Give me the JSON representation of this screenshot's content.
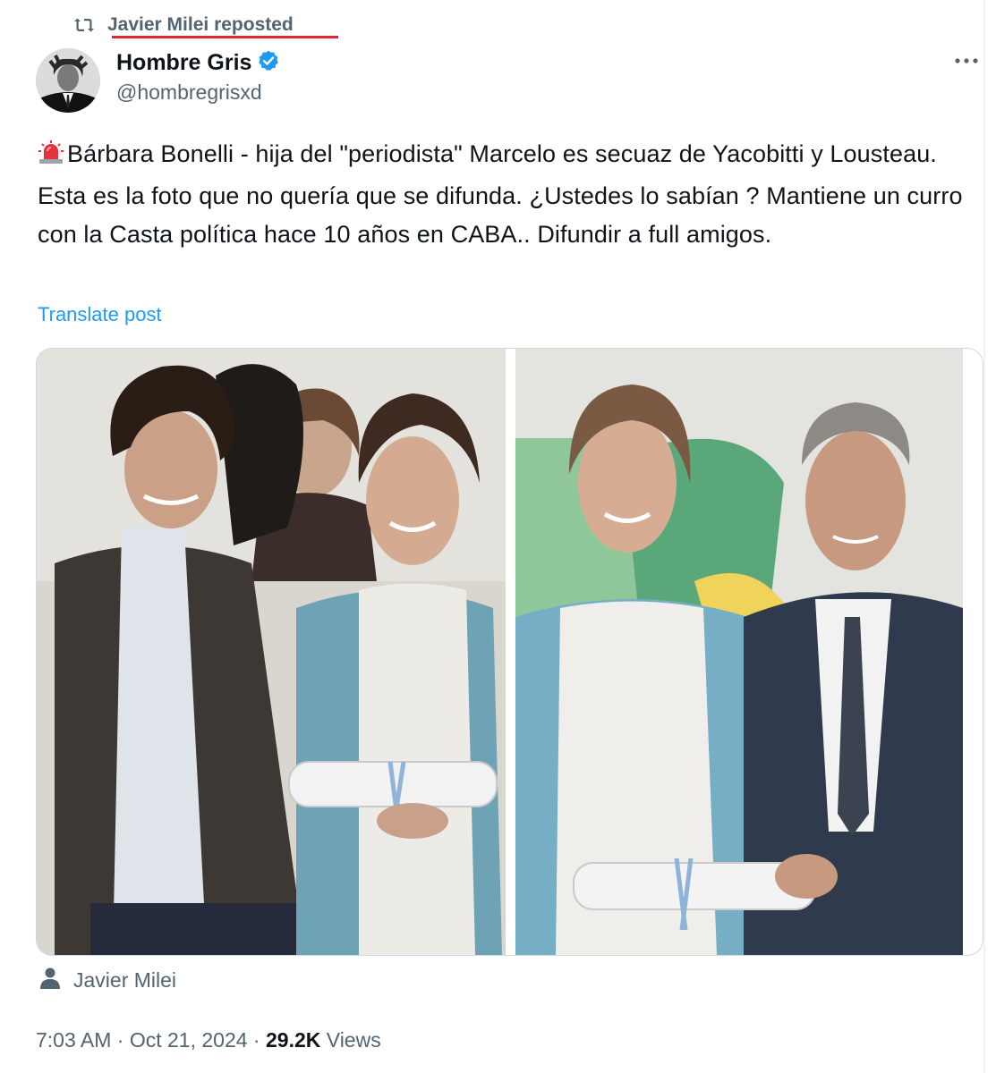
{
  "repost": {
    "icon": "repost-icon",
    "text": "Javier Milei reposted"
  },
  "author": {
    "display_name": "Hombre Gris",
    "verified": true,
    "verified_icon": "verified-badge-icon",
    "handle": "@hombregrisxd"
  },
  "more_icon": "more-options-icon",
  "post": {
    "emoji": "police-siren-icon",
    "text": "Bárbara Bonelli - hija del \"periodista\" Marcelo es secuaz de Yacobitti y Lousteau.  Esta es la foto que no quería que se difunda. ¿Ustedes lo sabían ? Mantiene un curro con la Casta política hace 10 años en CABA.. Difundir a full amigos.",
    "translate_label": "Translate post"
  },
  "media": {
    "photos": [
      {
        "name": "photo-left"
      },
      {
        "name": "photo-right"
      }
    ]
  },
  "tagged": {
    "icon": "person-icon",
    "name": "Javier Milei"
  },
  "meta": {
    "time": "7:03 AM",
    "separator": " · ",
    "date": "Oct 21, 2024",
    "views_count": "29.2K",
    "views_label": " Views"
  },
  "colors": {
    "accent": "#1d9bf0",
    "secondary_text": "#536471",
    "primary_text": "#0f1419",
    "underline_highlight": "#e0262e"
  }
}
